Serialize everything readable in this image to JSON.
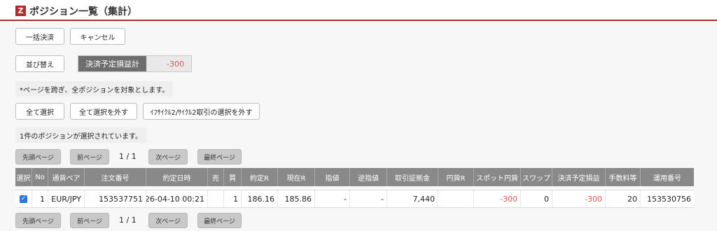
{
  "header": {
    "logo_text": "Z",
    "title": "ポジション一覧（集計）"
  },
  "actions": {
    "bulk_settle": "一括決済",
    "cancel": "キャンセル",
    "sort": "並び替え"
  },
  "summary": {
    "label": "決済予定損益計",
    "value": "-300"
  },
  "notes": {
    "cross_page": "*ページを跨ぎ、全ポジションを対象とします。",
    "selected_count": "1件のポジションが選択されています。"
  },
  "select": {
    "select_all": "全て選択",
    "deselect_all": "全て選択を外す",
    "deselect_cycle": "ｲﾌｻｲｸﾙ2/ｻｲｸﾙ2取引の選択を外す"
  },
  "pager": {
    "first": "先頭ページ",
    "prev": "前ページ",
    "info": "1 / 1",
    "next": "次ページ",
    "last": "最終ページ"
  },
  "table": {
    "headers": [
      "選択",
      "No",
      "通貨ペア",
      "注文番号",
      "約定日時",
      "売",
      "買",
      "約定R",
      "現在R",
      "指値",
      "逆指値",
      "取引証拠金",
      "円貨R",
      "スポット円貨",
      "スワップ",
      "決済予定損益",
      "手数料等",
      "運用番号"
    ],
    "rows": [
      {
        "checked": "✓",
        "no": "1",
        "pair": "EUR/JPY",
        "order_no": "153537751",
        "datetime": "26-04-10 00:21",
        "sell": "",
        "buy": "1",
        "contract_rate": "186.16",
        "current_rate": "185.86",
        "limit": "-",
        "stop": "-",
        "margin": "7,440",
        "yen_rate": "",
        "spot_yen": "-300",
        "swap": "0",
        "planned_pl": "-300",
        "fee": "20",
        "op_no": "153530756"
      }
    ]
  },
  "colors": {
    "brand": "#b5282d",
    "negative": "#e05555",
    "header_bg": "#898989",
    "check": "#2d73e8"
  }
}
